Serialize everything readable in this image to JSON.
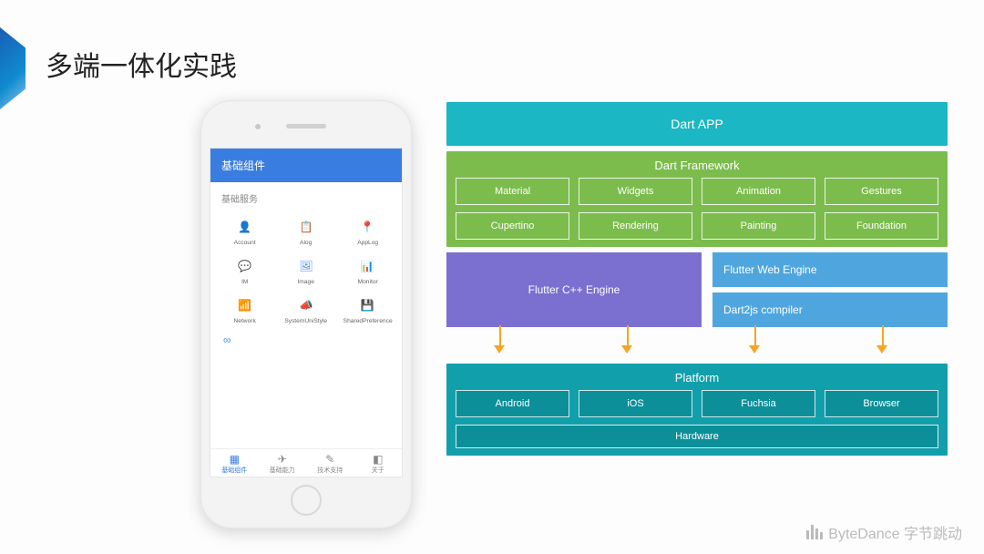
{
  "slide": {
    "title": "多端一体化实践",
    "footer": "ByteDance 字节跳动"
  },
  "phone": {
    "appbar_title": "基础组件",
    "section_label": "基础服务",
    "grid_items": [
      {
        "icon": "👤",
        "label": "Account"
      },
      {
        "icon": "📋",
        "label": "Alog"
      },
      {
        "icon": "📍",
        "label": "AppLog"
      },
      {
        "icon": "💬",
        "label": "IM"
      },
      {
        "icon": "🖼",
        "label": "Image"
      },
      {
        "icon": "📊",
        "label": "Monitor"
      },
      {
        "icon": "📶",
        "label": "Network"
      },
      {
        "icon": "📣",
        "label": "SystemUniStyle"
      },
      {
        "icon": "💾",
        "label": "SharedPreference"
      }
    ],
    "extra_glyph": "∞",
    "tabs": [
      {
        "icon": "▦",
        "label": "基础组件",
        "active": true
      },
      {
        "icon": "✈",
        "label": "基础能力",
        "active": false
      },
      {
        "icon": "✎",
        "label": "技术支持",
        "active": false
      },
      {
        "icon": "◧",
        "label": "关于",
        "active": false
      }
    ]
  },
  "diagram": {
    "dart_app": "Dart APP",
    "dart_framework": {
      "title": "Dart Framework",
      "row1": [
        "Material",
        "Widgets",
        "Animation",
        "Gestures"
      ],
      "row2": [
        "Cupertino",
        "Rendering",
        "Painting",
        "Foundation"
      ]
    },
    "cpp_engine": "Flutter C++ Engine",
    "web_engine": "Flutter Web Engine",
    "dart2js": "Dart2js compiler",
    "platform": {
      "title": "Platform",
      "targets": [
        "Android",
        "iOS",
        "Fuchsia",
        "Browser"
      ],
      "hardware": "Hardware"
    }
  }
}
